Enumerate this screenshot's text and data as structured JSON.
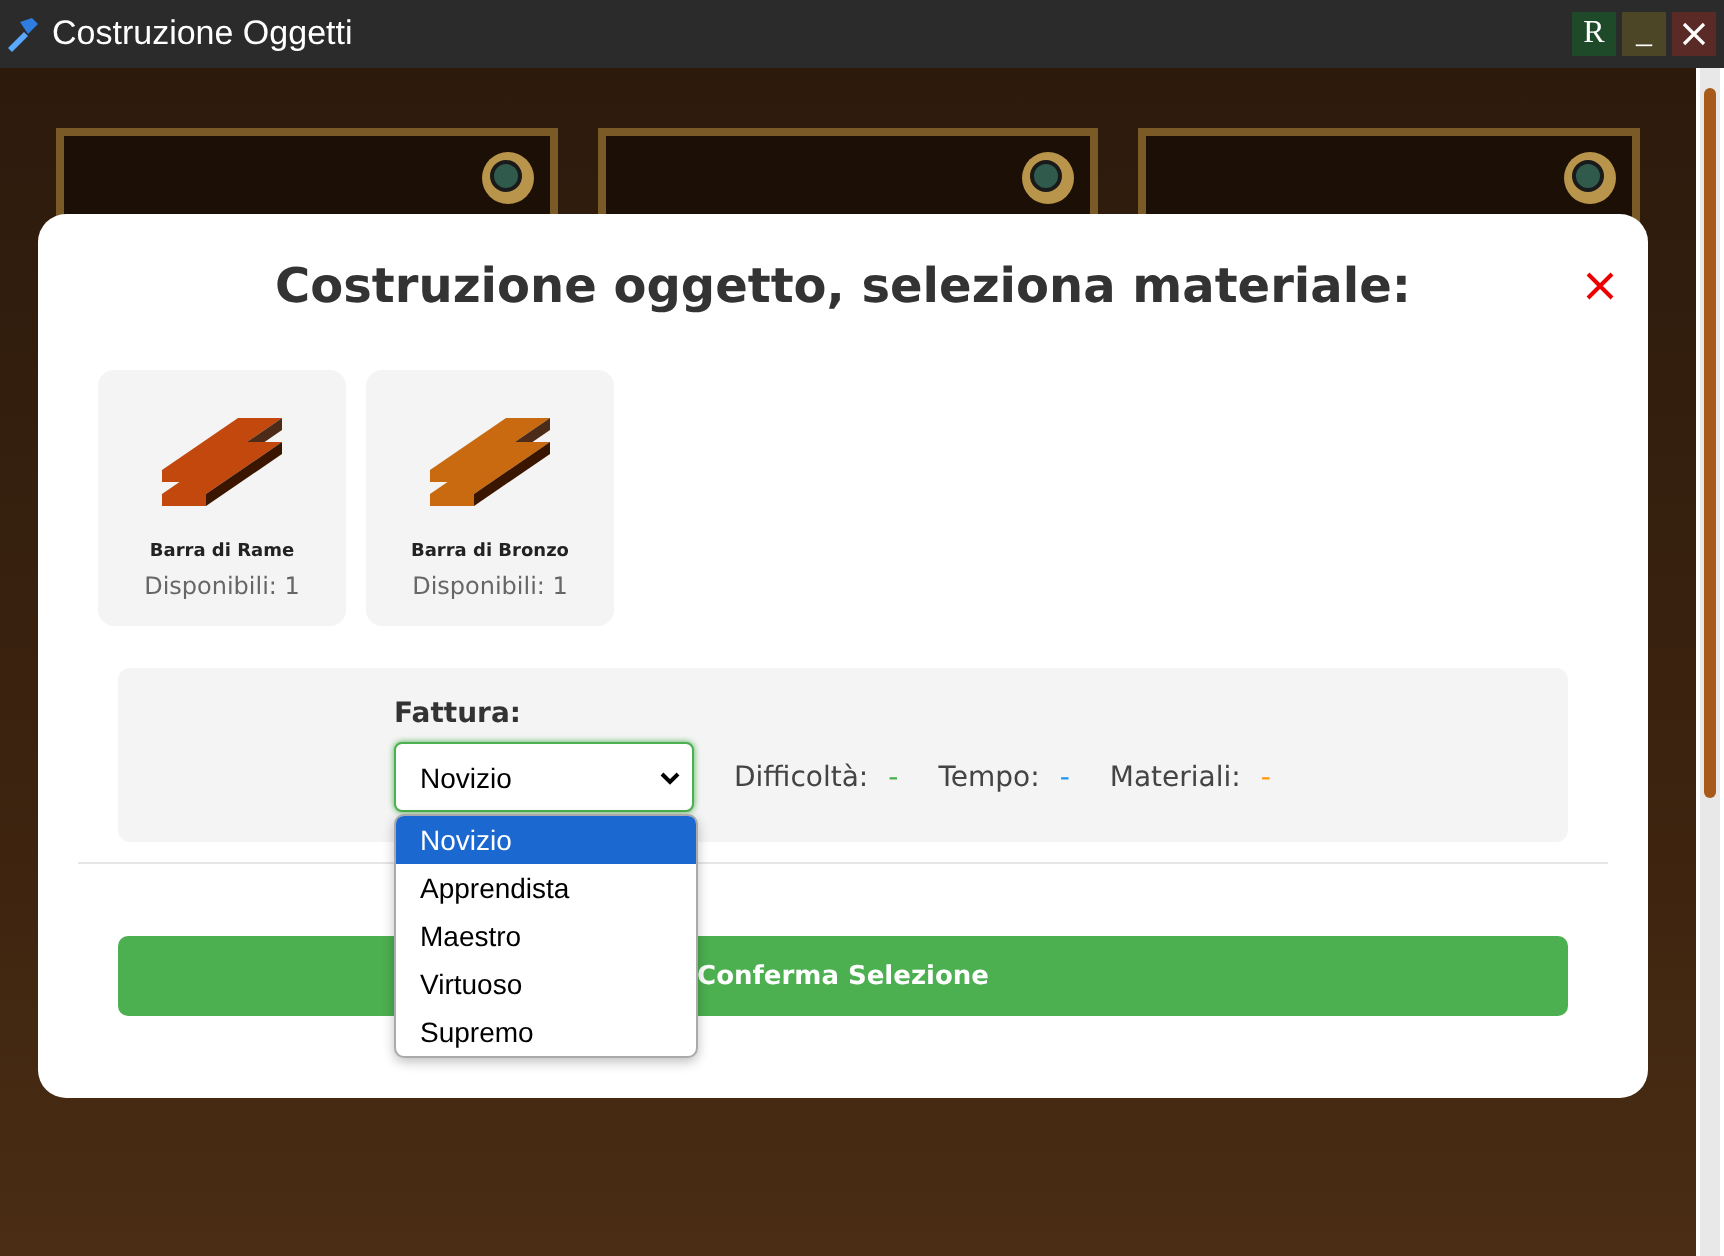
{
  "window": {
    "title": "Costruzione Oggetti",
    "buttons": [
      "R",
      "_"
    ]
  },
  "dialog": {
    "title": "Costruzione oggetto, seleziona materiale:",
    "materials": [
      {
        "name": "Barra di Rame",
        "available": "Disponibili: 1",
        "color": "#c2480e"
      },
      {
        "name": "Barra di Bronzo",
        "available": "Disponibili: 1",
        "color": "#c96a10"
      }
    ],
    "quality": {
      "label": "Fattura:",
      "value": "Novizio",
      "expanded": true,
      "options": [
        {
          "label": "Novizio",
          "selected": true
        },
        {
          "label": "Apprendista",
          "selected": false
        },
        {
          "label": "Maestro",
          "selected": false
        },
        {
          "label": "Virtuoso",
          "selected": false
        },
        {
          "label": "Supremo",
          "selected": false
        }
      ]
    },
    "stats": [
      {
        "label": "Difficoltà:",
        "value": "-",
        "color": "#4caf50"
      },
      {
        "label": "Tempo:",
        "value": "-",
        "color": "#2196f3"
      },
      {
        "label": "Materiali:",
        "value": "-",
        "color": "#ff9800"
      }
    ],
    "confirm": "Conferma Selezione"
  }
}
